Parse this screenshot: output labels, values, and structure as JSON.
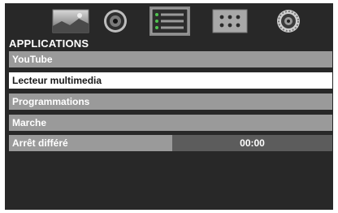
{
  "tabs": [
    {
      "icon": "picture-icon",
      "selected": false
    },
    {
      "icon": "speaker-icon",
      "selected": false
    },
    {
      "icon": "applications-icon",
      "selected": true
    },
    {
      "icon": "grid-icon",
      "selected": false
    },
    {
      "icon": "settings-icon",
      "selected": false
    }
  ],
  "section_title": "APPLICATIONS",
  "menu": {
    "items": [
      {
        "label": "YouTube",
        "selected": false
      },
      {
        "label": "Lecteur multimedia",
        "selected": true
      },
      {
        "label": "Programmations",
        "selected": false
      },
      {
        "label": "Marche",
        "selected": false
      },
      {
        "label": "Arrêt différé",
        "selected": false,
        "value": "00:00"
      }
    ]
  },
  "colors": {
    "background": "#282828",
    "row": "#9a9a9a",
    "row_selected": "#ffffff",
    "value_box": "#5c5c5c"
  }
}
